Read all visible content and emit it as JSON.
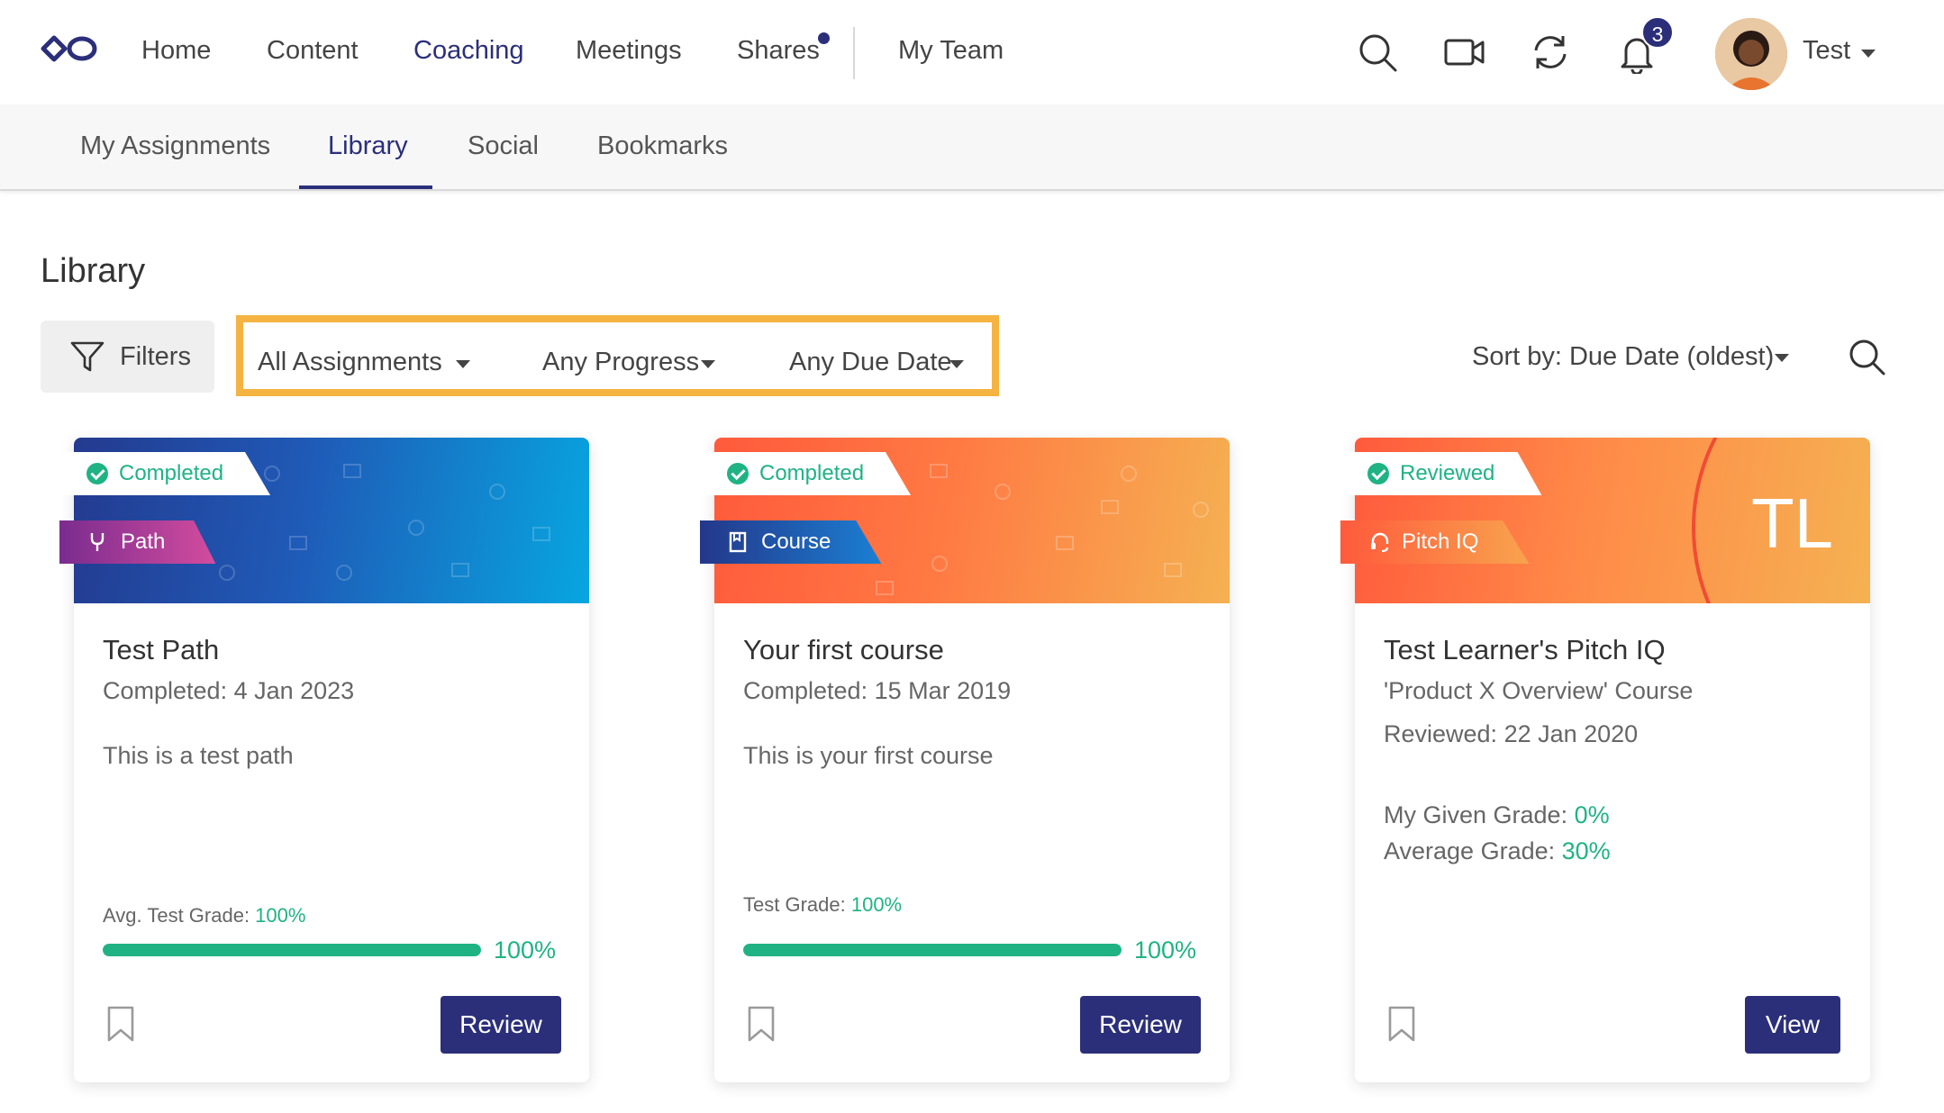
{
  "nav": {
    "items": [
      {
        "label": "Home"
      },
      {
        "label": "Content"
      },
      {
        "label": "Coaching"
      },
      {
        "label": "Meetings"
      },
      {
        "label": "Shares"
      },
      {
        "label": "My Team"
      }
    ],
    "notification_count": "3",
    "user_name": "Test",
    "icons": [
      "logo-icon",
      "search-icon",
      "video-icon",
      "sync-icon",
      "bell-icon"
    ]
  },
  "subnav": {
    "tabs": [
      {
        "label": "My Assignments"
      },
      {
        "label": "Library"
      },
      {
        "label": "Social"
      },
      {
        "label": "Bookmarks"
      }
    ],
    "active": "Library"
  },
  "page": {
    "title": "Library",
    "filters_label": "Filters",
    "dropdowns": [
      "All Assignments",
      "Any Progress",
      "Any Due Date"
    ],
    "sort_label": "Sort by: Due Date (oldest)"
  },
  "cards": [
    {
      "status": "Completed",
      "type": "Path",
      "title": "Test Path",
      "line1": "Completed: 4 Jan 2023",
      "description": "This is a test path",
      "grade_label": "Avg. Test Grade: ",
      "grade_value": "100%",
      "progress": 1.0,
      "progress_label": "100%",
      "button": "Review"
    },
    {
      "status": "Completed",
      "type": "Course",
      "title": "Your first course",
      "line1": "Completed: 15 Mar 2019",
      "description": "This is your first course",
      "grade_label": "Test Grade: ",
      "grade_value": "100%",
      "progress": 1.0,
      "progress_label": "100%",
      "button": "Review"
    },
    {
      "status": "Reviewed",
      "type": "Pitch IQ",
      "initials": "TL",
      "title": "Test Learner's Pitch IQ",
      "line1": "'Product X Overview' Course",
      "line2": "Reviewed: 22 Jan 2020",
      "given_grade_label": "My Given Grade: ",
      "given_grade_value": "0%",
      "avg_grade_label": "Average Grade: ",
      "avg_grade_value": "30%",
      "button": "View"
    }
  ],
  "colors": {
    "brand": "#2b2f7a",
    "success": "#1fb383",
    "highlight": "#f5b342"
  }
}
